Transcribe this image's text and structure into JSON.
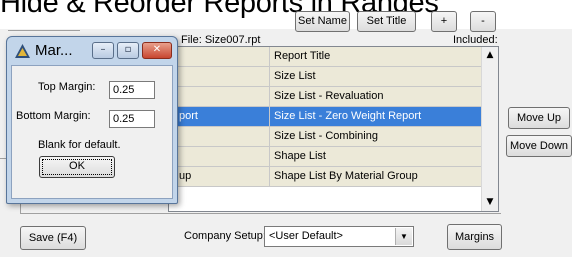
{
  "heading": {
    "text": "Hide & Reorder Reports in Ranges"
  },
  "toolbar": {
    "set_name_label": "Set Name",
    "set_title_label": "Set Title",
    "add_label": "+",
    "remove_label": "-"
  },
  "report_file_label": "File: Size007.rpt",
  "included_label": "Included:",
  "grid": {
    "header": {
      "left": "",
      "right": "Report Title"
    },
    "rows": [
      {
        "left": "",
        "right": "Size List",
        "selected": false
      },
      {
        "left": "",
        "right": "Size List - Revaluation",
        "selected": false
      },
      {
        "left": "port",
        "right": "Size List - Zero Weight Report",
        "selected": true
      },
      {
        "left": "",
        "right": "Size List - Combining",
        "selected": false
      },
      {
        "left": "",
        "right": "Shape List",
        "selected": false
      },
      {
        "left": "up",
        "right": "Shape List By Material Group",
        "selected": false
      }
    ]
  },
  "side_buttons": {
    "move_up_label": "Move Up",
    "move_down_label": "Move Down"
  },
  "bottom": {
    "save_label": "Save (F4)",
    "company_setup_label": "Company Setup:",
    "company_setup_value": "<User Default>",
    "margins_label": "Margins"
  },
  "dialog": {
    "title": "Mar...",
    "top_margin_label": "Top Margin:",
    "top_margin_value": "0.25",
    "bottom_margin_label": "Bottom Margin:",
    "bottom_margin_value": "0.25",
    "hint": "Blank for default.",
    "ok_label": "OK"
  },
  "icons": {
    "dialog_icon": "app-icon",
    "minimize": "minimize-icon",
    "maximize": "maximize-icon",
    "close": "close-icon",
    "scroll_up": "scroll-up-arrow",
    "scroll_down": "scroll-down-arrow",
    "combo_drop": "dropdown-arrow"
  },
  "colors": {
    "selected_row": "#3a7fd9",
    "row_background": "#ece9d8",
    "dialog_frame": "#c2d5ea",
    "close_button": "#c84630"
  }
}
